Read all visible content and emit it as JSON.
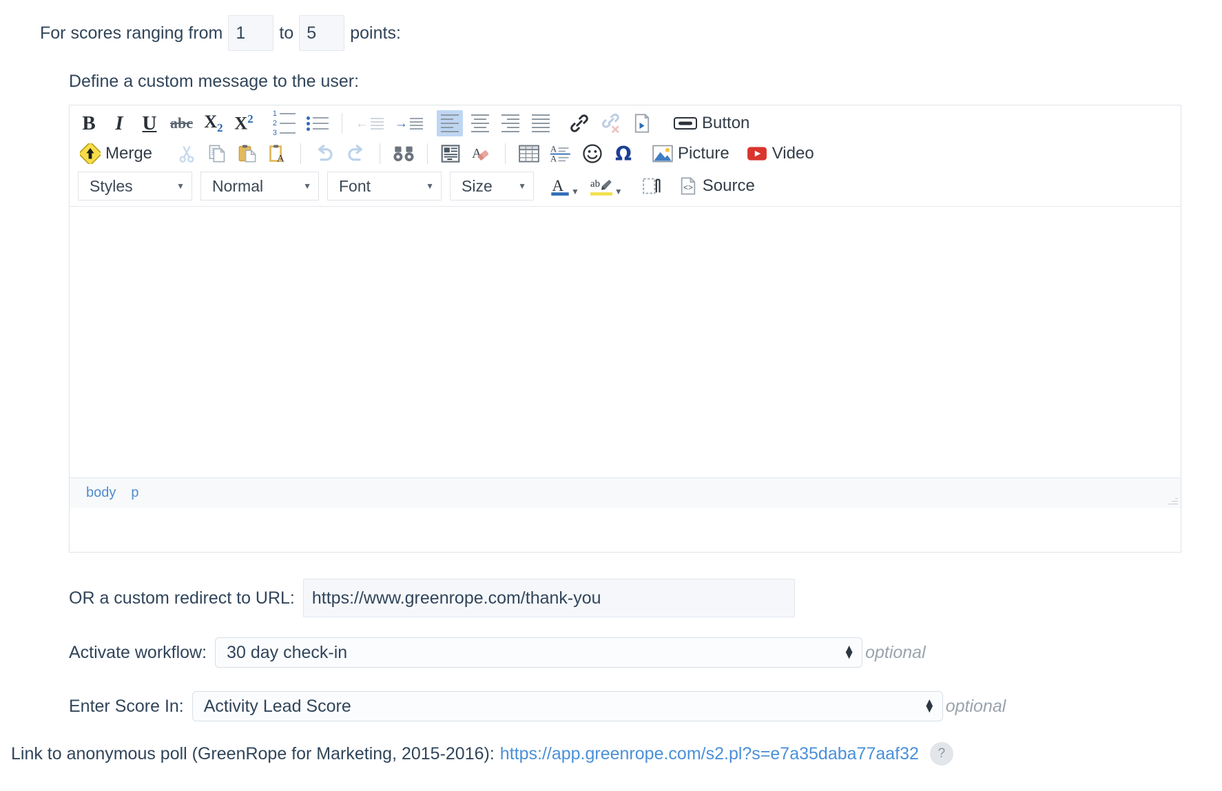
{
  "score_range": {
    "prefix": "For scores ranging from",
    "from_value": "1",
    "middle": "to",
    "to_value": "5",
    "suffix": "points:"
  },
  "message_label": "Define a custom message to the user:",
  "editor": {
    "toolbar_row1": [
      {
        "name": "bold-icon",
        "glyph": "B",
        "kind": "bold"
      },
      {
        "name": "italic-icon",
        "glyph": "I",
        "kind": "italic"
      },
      {
        "name": "underline-icon",
        "glyph": "U",
        "kind": "underline"
      },
      {
        "name": "strikethrough-icon",
        "glyph": "abc",
        "kind": "strike"
      },
      {
        "name": "subscript-icon",
        "glyph": "X",
        "sup": "2",
        "kind": "sub"
      },
      {
        "name": "superscript-icon",
        "glyph": "X",
        "sup": "2",
        "kind": "sup"
      },
      {
        "name": "numbered-list-icon",
        "kind": "numlist"
      },
      {
        "name": "bulleted-list-icon",
        "kind": "bullist"
      },
      {
        "name": "outdent-icon",
        "kind": "outdent"
      },
      {
        "name": "indent-icon",
        "kind": "indent"
      },
      {
        "name": "align-left-icon",
        "kind": "align-l",
        "active": true
      },
      {
        "name": "align-center-icon",
        "kind": "align-c"
      },
      {
        "name": "align-right-icon",
        "kind": "align-r"
      },
      {
        "name": "justify-icon",
        "kind": "align-j"
      },
      {
        "name": "link-icon",
        "kind": "link"
      },
      {
        "name": "unlink-icon",
        "kind": "unlink"
      },
      {
        "name": "anchor-icon",
        "kind": "anchor"
      },
      {
        "name": "insert-button-icon",
        "kind": "button",
        "label": "Button"
      }
    ],
    "toolbar_row2": [
      {
        "name": "merge-field-icon",
        "kind": "merge",
        "label": "Merge"
      },
      {
        "name": "cut-icon",
        "kind": "cut"
      },
      {
        "name": "copy-icon",
        "kind": "copy"
      },
      {
        "name": "paste-icon",
        "kind": "paste"
      },
      {
        "name": "paste-as-text-icon",
        "kind": "paste-text"
      },
      {
        "name": "undo-icon",
        "kind": "undo"
      },
      {
        "name": "redo-icon",
        "kind": "redo"
      },
      {
        "name": "find-replace-icon",
        "kind": "find"
      },
      {
        "name": "select-all-icon",
        "kind": "selectall"
      },
      {
        "name": "remove-format-icon",
        "kind": "removeformat"
      },
      {
        "name": "table-icon",
        "kind": "table"
      },
      {
        "name": "line-height-icon",
        "kind": "lineheight"
      },
      {
        "name": "smiley-icon",
        "kind": "smiley"
      },
      {
        "name": "special-character-icon",
        "kind": "omega"
      },
      {
        "name": "picture-icon",
        "kind": "picture",
        "label": "Picture"
      },
      {
        "name": "video-icon",
        "kind": "video",
        "label": "Video"
      }
    ],
    "toolbar_row3": {
      "styles_label": "Styles",
      "format_label": "Normal",
      "font_label": "Font",
      "size_label": "Size",
      "text_color_glyph": "A",
      "highlight_glyph": "ab",
      "show_blocks_name": "show-blocks-icon",
      "source_label": "Source"
    },
    "content": "",
    "elements_path": [
      "body",
      "p"
    ]
  },
  "redirect": {
    "label": "OR a custom redirect to URL:",
    "value": "https://www.greenrope.com/thank-you",
    "placeholder": ""
  },
  "workflow": {
    "label": "Activate workflow:",
    "value": "30 day check-in",
    "optional": "optional"
  },
  "score_in": {
    "label": "Enter Score In:",
    "value": "Activity Lead Score",
    "optional": "optional"
  },
  "footer": {
    "text": "Link to anonymous poll (GreenRope for Marketing, 2015-2016):",
    "link": "https://app.greenrope.com/s2.pl?s=e7a35daba77aaf32",
    "help": "?"
  },
  "colors": {
    "text": "#31455a",
    "link": "#4a90d9",
    "active_toolbar": "#bed6f2",
    "field_bg": "#f5f7fa",
    "border": "#dfe3e8"
  }
}
